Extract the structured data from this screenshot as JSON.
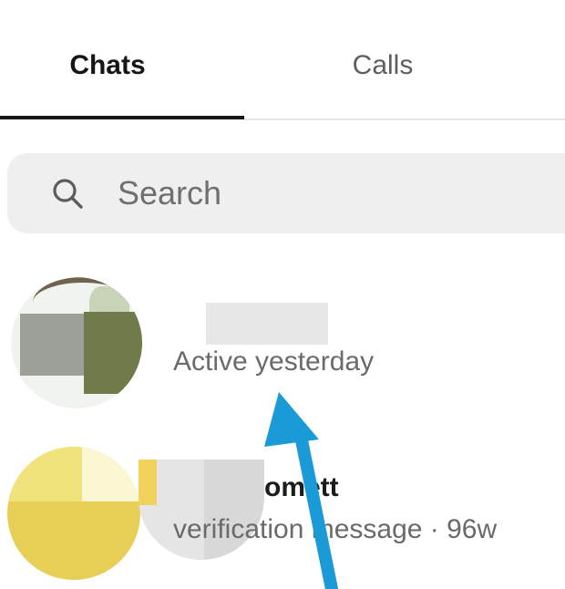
{
  "tabs": {
    "chats_label": "Chats",
    "calls_label": "Calls"
  },
  "search": {
    "placeholder": "Search"
  },
  "conversations": [
    {
      "name": "",
      "subtitle": "Active yesterday"
    },
    {
      "name": "omett",
      "subtitle": "verification message · 96w"
    }
  ],
  "colors": {
    "active_tab": "#161616",
    "inactive_tab": "#5e5e5e",
    "search_bg": "#efefef",
    "arrow": "#1a9ad6"
  }
}
